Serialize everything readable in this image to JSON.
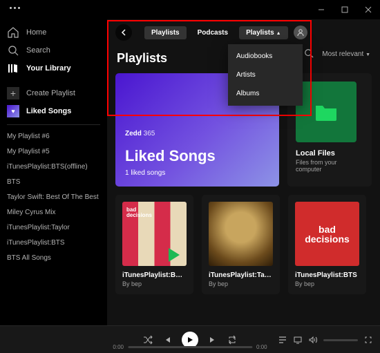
{
  "sidebar": {
    "home": "Home",
    "search": "Search",
    "library": "Your Library",
    "create": "Create Playlist",
    "liked": "Liked Songs",
    "playlists": [
      "My Playlist #6",
      "My Playlist #5",
      "iTunesPlaylist:BTS(offline)",
      "BTS",
      "Taylor Swift: Best Of The Best",
      "Miley Cyrus Mix",
      "iTunesPlaylist:Taylor",
      "iTunesPlaylist:BTS",
      "BTS All Songs"
    ]
  },
  "topbar": {
    "tab_playlists": "Playlists",
    "tab_podcasts": "Podcasts",
    "tab_drop": "Playlists"
  },
  "dropdown": [
    "Audiobooks",
    "Artists",
    "Albums"
  ],
  "page_title": "Playlists",
  "sort": "Most relevant",
  "liked_card": {
    "history_artist": "Zedd",
    "history_track": "365",
    "title": "Liked Songs",
    "count": "1 liked songs"
  },
  "file_card": {
    "title": "Local Files",
    "sub": "Files from your computer"
  },
  "plcards": [
    {
      "title": "iTunesPlaylist:BTS(...",
      "by": "By bep"
    },
    {
      "title": "iTunesPlaylist:Taylor",
      "by": "By bep"
    },
    {
      "title": "iTunesPlaylist:BTS",
      "by": "By bep"
    }
  ],
  "t3_text": "bad decisions",
  "player": {
    "t1": "0:00",
    "t2": "0:00"
  }
}
